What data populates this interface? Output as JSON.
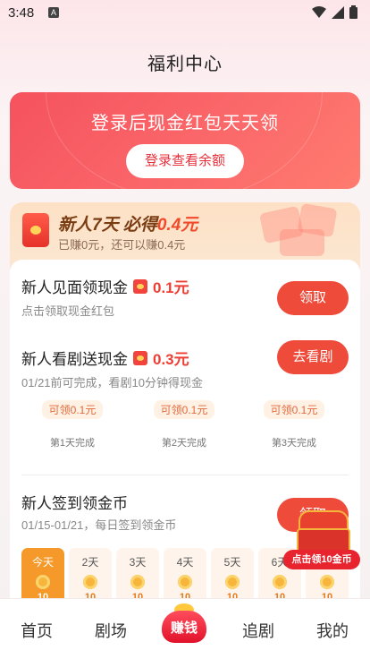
{
  "status": {
    "time": "3:48",
    "notif_icon": "A"
  },
  "page": {
    "title": "福利中心"
  },
  "login": {
    "headline": "登录后现金红包天天领",
    "button": "登录查看余额"
  },
  "newbie": {
    "title_prefix": "新人7天",
    "title_mid": " 必得",
    "title_amount": "0.4元",
    "subtitle": "已赚0元，还可以赚0.4元"
  },
  "tasks": [
    {
      "title": "新人见面领现金",
      "reward": "0.1元",
      "desc": "点击领取现金红包",
      "action": "领取"
    },
    {
      "title": "新人看剧送现金",
      "reward": "0.3元",
      "desc": "01/21前可完成，看剧10分钟得现金",
      "action": "去看剧"
    },
    {
      "title": "新人签到领金币",
      "reward": "",
      "desc": "01/15-01/21，每日签到领金币",
      "action": "领取"
    }
  ],
  "progress": [
    {
      "pill": "可领0.1元",
      "label": "第1天完成"
    },
    {
      "pill": "可领0.1元",
      "label": "第2天完成"
    },
    {
      "pill": "可领0.1元",
      "label": "第3天完成"
    }
  ],
  "checkin_days": [
    {
      "label": "今天",
      "value": "10"
    },
    {
      "label": "2天",
      "value": "10"
    },
    {
      "label": "3天",
      "value": "10"
    },
    {
      "label": "4天",
      "value": "10"
    },
    {
      "label": "5天",
      "value": "10"
    },
    {
      "label": "6天",
      "value": "10"
    },
    {
      "label": "7天",
      "value": "10"
    }
  ],
  "chest": {
    "tag": "点击领10金币"
  },
  "tabbar": {
    "home": "首页",
    "theater": "剧场",
    "earn": "赚钱",
    "follow": "追剧",
    "mine": "我的"
  },
  "colors": {
    "accent_red": "#ee4b3b",
    "today_orange": "#f59a2a"
  }
}
